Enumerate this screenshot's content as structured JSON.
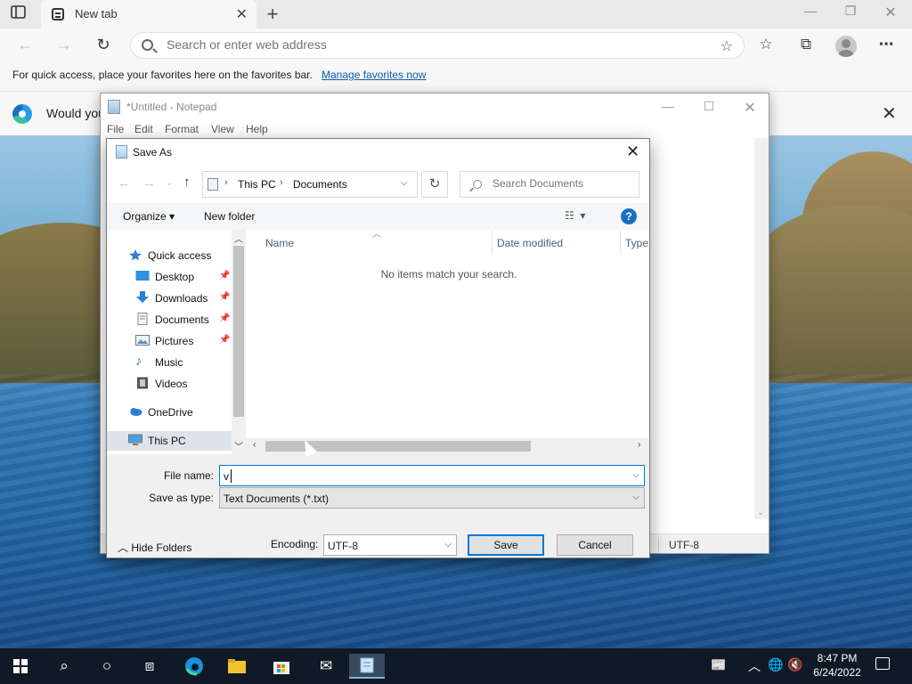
{
  "browser": {
    "tab_title": "New tab",
    "address_placeholder": "Search or enter web address",
    "favbar_text": "For quick access, place your favorites here on the favorites bar.",
    "favbar_link": "Manage favorites now",
    "infobar_text": "Would you"
  },
  "notepad": {
    "title": "*Untitled - Notepad",
    "menu": [
      "File",
      "Edit",
      "Format",
      "View",
      "Help"
    ],
    "status_encoding": "UTF-8"
  },
  "saveas": {
    "title": "Save As",
    "path": [
      "This PC",
      "Documents"
    ],
    "search_placeholder": "Search Documents",
    "organize": "Organize",
    "new_folder": "New folder",
    "tree": [
      {
        "label": "Quick access",
        "icon": "star-icon",
        "top": true
      },
      {
        "label": "Desktop",
        "icon": "desktop-icon",
        "pinned": true
      },
      {
        "label": "Downloads",
        "icon": "download-icon",
        "pinned": true
      },
      {
        "label": "Documents",
        "icon": "documents-icon",
        "pinned": true
      },
      {
        "label": "Pictures",
        "icon": "pictures-icon",
        "pinned": true
      },
      {
        "label": "Music",
        "icon": "music-icon"
      },
      {
        "label": "Videos",
        "icon": "videos-icon"
      },
      {
        "label": "OneDrive",
        "icon": "cloud-icon",
        "top": true
      },
      {
        "label": "This PC",
        "icon": "computer-icon",
        "top": true,
        "selected": true
      }
    ],
    "columns": [
      "Name",
      "Date modified",
      "Type"
    ],
    "empty_message": "No items match your search.",
    "file_name_label": "File name:",
    "file_name_value": "v",
    "save_type_label": "Save as type:",
    "save_type_value": "Text Documents (*.txt)",
    "hide_folders": "Hide Folders",
    "encoding_label": "Encoding:",
    "encoding_value": "UTF-8",
    "save_button": "Save",
    "cancel_button": "Cancel"
  },
  "taskbar": {
    "time": "8:47 PM",
    "date": "6/24/2022"
  },
  "colors": {
    "accent": "#0078d7",
    "link": "#0b5cad",
    "taskbar": "#0f1a26"
  }
}
